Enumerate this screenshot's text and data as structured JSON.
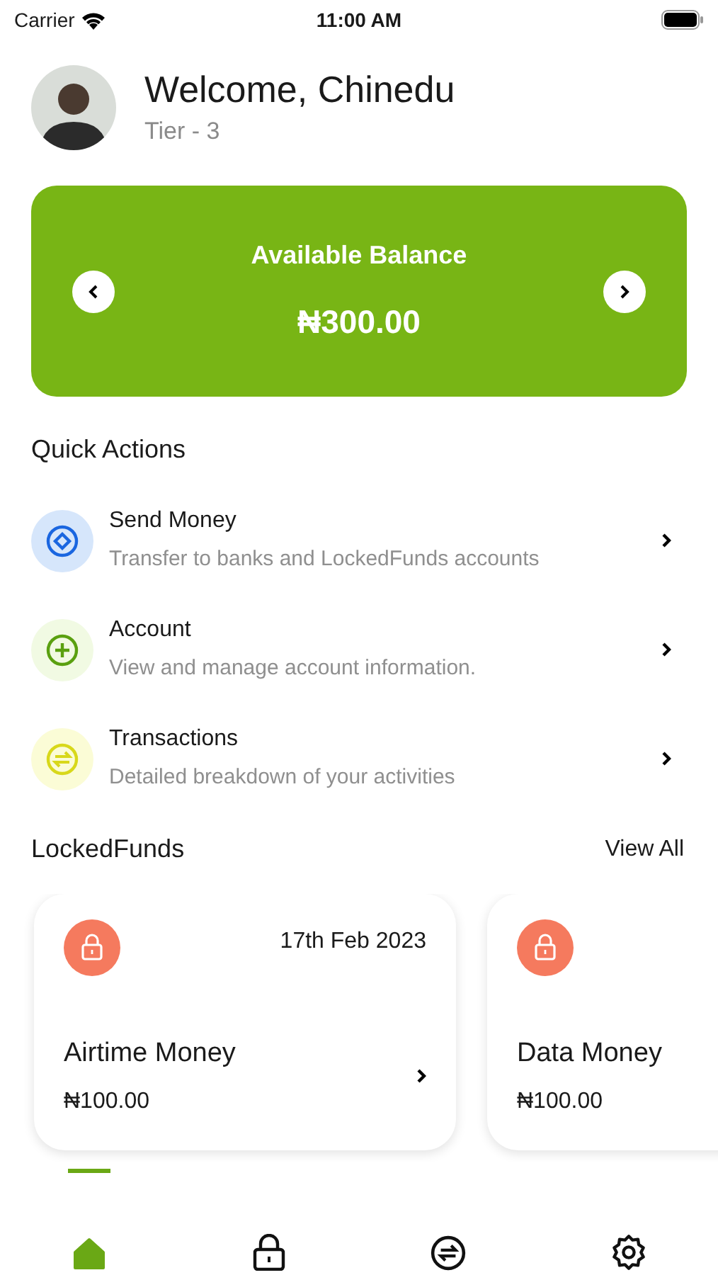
{
  "status_bar": {
    "carrier": "Carrier",
    "time": "11:00 AM"
  },
  "header": {
    "greeting": "Welcome, Chinedu",
    "tier": "Tier - 3"
  },
  "balance_card": {
    "title": "Available Balance",
    "amount": "₦300.00"
  },
  "quick_actions": {
    "title": "Quick Actions",
    "items": [
      {
        "kind": "send",
        "color": "#d6e6fb",
        "title": "Send Money",
        "subtitle": "Transfer to banks and LockedFunds accounts"
      },
      {
        "kind": "account",
        "color": "#f1fae3",
        "title": "Account",
        "subtitle": "View and manage account information."
      },
      {
        "kind": "transactions",
        "color": "#fbfcd6",
        "title": "Transactions",
        "subtitle": "Detailed breakdown of your activities"
      }
    ]
  },
  "locked_funds": {
    "title": "LockedFunds",
    "view_all": "View All",
    "cards": [
      {
        "date": "17th Feb 2023",
        "name": "Airtime Money",
        "amount": "₦100.00"
      },
      {
        "name": "Data Money",
        "amount": "₦100.00"
      }
    ]
  },
  "tab_bar": [
    {
      "kind": "home",
      "selected": true
    },
    {
      "kind": "lock",
      "selected": false
    },
    {
      "kind": "exchange",
      "selected": false
    },
    {
      "kind": "settings",
      "selected": false
    }
  ]
}
